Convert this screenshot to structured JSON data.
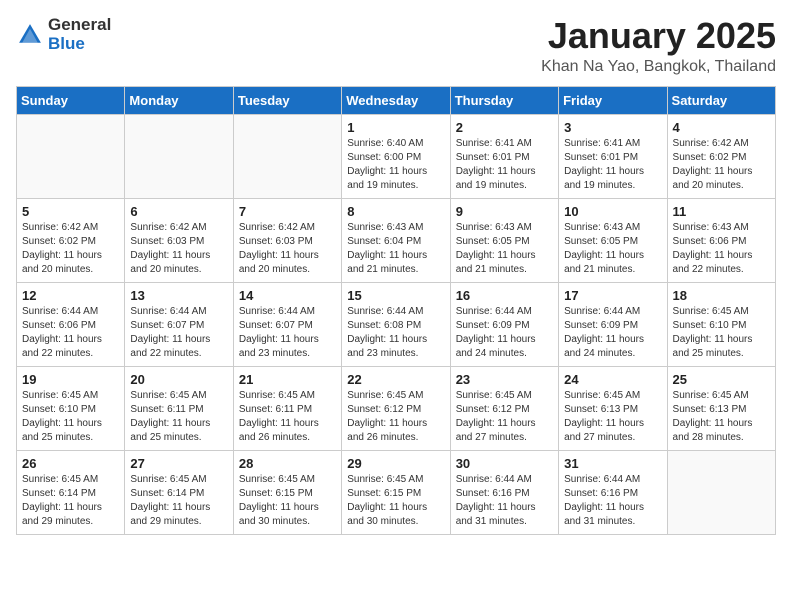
{
  "logo": {
    "general": "General",
    "blue": "Blue"
  },
  "title": "January 2025",
  "subtitle": "Khan Na Yao, Bangkok, Thailand",
  "weekdays": [
    "Sunday",
    "Monday",
    "Tuesday",
    "Wednesday",
    "Thursday",
    "Friday",
    "Saturday"
  ],
  "weeks": [
    [
      {
        "day": "",
        "info": ""
      },
      {
        "day": "",
        "info": ""
      },
      {
        "day": "",
        "info": ""
      },
      {
        "day": "1",
        "info": "Sunrise: 6:40 AM\nSunset: 6:00 PM\nDaylight: 11 hours and 19 minutes."
      },
      {
        "day": "2",
        "info": "Sunrise: 6:41 AM\nSunset: 6:01 PM\nDaylight: 11 hours and 19 minutes."
      },
      {
        "day": "3",
        "info": "Sunrise: 6:41 AM\nSunset: 6:01 PM\nDaylight: 11 hours and 19 minutes."
      },
      {
        "day": "4",
        "info": "Sunrise: 6:42 AM\nSunset: 6:02 PM\nDaylight: 11 hours and 20 minutes."
      }
    ],
    [
      {
        "day": "5",
        "info": "Sunrise: 6:42 AM\nSunset: 6:02 PM\nDaylight: 11 hours and 20 minutes."
      },
      {
        "day": "6",
        "info": "Sunrise: 6:42 AM\nSunset: 6:03 PM\nDaylight: 11 hours and 20 minutes."
      },
      {
        "day": "7",
        "info": "Sunrise: 6:42 AM\nSunset: 6:03 PM\nDaylight: 11 hours and 20 minutes."
      },
      {
        "day": "8",
        "info": "Sunrise: 6:43 AM\nSunset: 6:04 PM\nDaylight: 11 hours and 21 minutes."
      },
      {
        "day": "9",
        "info": "Sunrise: 6:43 AM\nSunset: 6:05 PM\nDaylight: 11 hours and 21 minutes."
      },
      {
        "day": "10",
        "info": "Sunrise: 6:43 AM\nSunset: 6:05 PM\nDaylight: 11 hours and 21 minutes."
      },
      {
        "day": "11",
        "info": "Sunrise: 6:43 AM\nSunset: 6:06 PM\nDaylight: 11 hours and 22 minutes."
      }
    ],
    [
      {
        "day": "12",
        "info": "Sunrise: 6:44 AM\nSunset: 6:06 PM\nDaylight: 11 hours and 22 minutes."
      },
      {
        "day": "13",
        "info": "Sunrise: 6:44 AM\nSunset: 6:07 PM\nDaylight: 11 hours and 22 minutes."
      },
      {
        "day": "14",
        "info": "Sunrise: 6:44 AM\nSunset: 6:07 PM\nDaylight: 11 hours and 23 minutes."
      },
      {
        "day": "15",
        "info": "Sunrise: 6:44 AM\nSunset: 6:08 PM\nDaylight: 11 hours and 23 minutes."
      },
      {
        "day": "16",
        "info": "Sunrise: 6:44 AM\nSunset: 6:09 PM\nDaylight: 11 hours and 24 minutes."
      },
      {
        "day": "17",
        "info": "Sunrise: 6:44 AM\nSunset: 6:09 PM\nDaylight: 11 hours and 24 minutes."
      },
      {
        "day": "18",
        "info": "Sunrise: 6:45 AM\nSunset: 6:10 PM\nDaylight: 11 hours and 25 minutes."
      }
    ],
    [
      {
        "day": "19",
        "info": "Sunrise: 6:45 AM\nSunset: 6:10 PM\nDaylight: 11 hours and 25 minutes."
      },
      {
        "day": "20",
        "info": "Sunrise: 6:45 AM\nSunset: 6:11 PM\nDaylight: 11 hours and 25 minutes."
      },
      {
        "day": "21",
        "info": "Sunrise: 6:45 AM\nSunset: 6:11 PM\nDaylight: 11 hours and 26 minutes."
      },
      {
        "day": "22",
        "info": "Sunrise: 6:45 AM\nSunset: 6:12 PM\nDaylight: 11 hours and 26 minutes."
      },
      {
        "day": "23",
        "info": "Sunrise: 6:45 AM\nSunset: 6:12 PM\nDaylight: 11 hours and 27 minutes."
      },
      {
        "day": "24",
        "info": "Sunrise: 6:45 AM\nSunset: 6:13 PM\nDaylight: 11 hours and 27 minutes."
      },
      {
        "day": "25",
        "info": "Sunrise: 6:45 AM\nSunset: 6:13 PM\nDaylight: 11 hours and 28 minutes."
      }
    ],
    [
      {
        "day": "26",
        "info": "Sunrise: 6:45 AM\nSunset: 6:14 PM\nDaylight: 11 hours and 29 minutes."
      },
      {
        "day": "27",
        "info": "Sunrise: 6:45 AM\nSunset: 6:14 PM\nDaylight: 11 hours and 29 minutes."
      },
      {
        "day": "28",
        "info": "Sunrise: 6:45 AM\nSunset: 6:15 PM\nDaylight: 11 hours and 30 minutes."
      },
      {
        "day": "29",
        "info": "Sunrise: 6:45 AM\nSunset: 6:15 PM\nDaylight: 11 hours and 30 minutes."
      },
      {
        "day": "30",
        "info": "Sunrise: 6:44 AM\nSunset: 6:16 PM\nDaylight: 11 hours and 31 minutes."
      },
      {
        "day": "31",
        "info": "Sunrise: 6:44 AM\nSunset: 6:16 PM\nDaylight: 11 hours and 31 minutes."
      },
      {
        "day": "",
        "info": ""
      }
    ]
  ]
}
